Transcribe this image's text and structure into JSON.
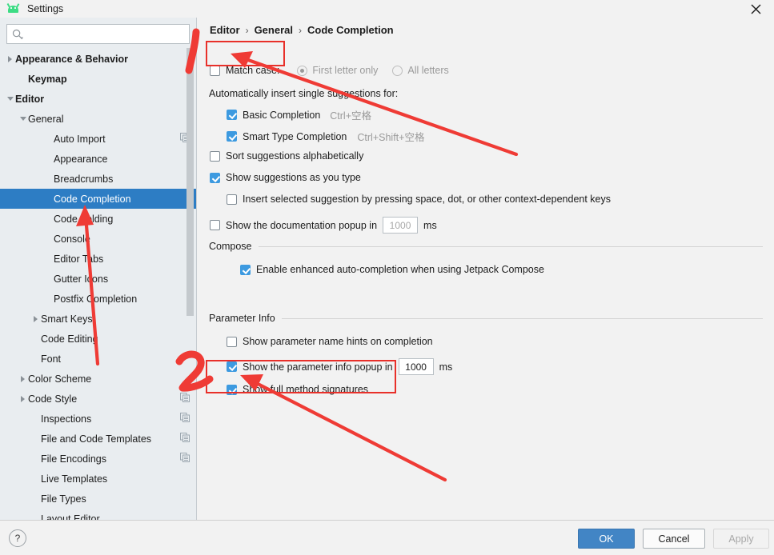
{
  "window": {
    "title": "Settings",
    "logo_icon": "android-logo-icon",
    "close_icon": "close-icon"
  },
  "sidebar": {
    "search": {
      "placeholder": "",
      "value": "",
      "icon": "search-icon"
    },
    "items": [
      {
        "label": "Appearance & Behavior",
        "indent": 0,
        "arrow": "right",
        "bold": true,
        "copy": false,
        "selected": false
      },
      {
        "label": "Keymap",
        "indent": 1,
        "arrow": "none",
        "bold": true,
        "copy": false,
        "selected": false
      },
      {
        "label": "Editor",
        "indent": 0,
        "arrow": "down",
        "bold": true,
        "copy": false,
        "selected": false
      },
      {
        "label": "General",
        "indent": 1,
        "arrow": "down",
        "bold": false,
        "copy": false,
        "selected": false
      },
      {
        "label": "Auto Import",
        "indent": 3,
        "arrow": "none",
        "bold": false,
        "copy": true,
        "selected": false
      },
      {
        "label": "Appearance",
        "indent": 3,
        "arrow": "none",
        "bold": false,
        "copy": false,
        "selected": false
      },
      {
        "label": "Breadcrumbs",
        "indent": 3,
        "arrow": "none",
        "bold": false,
        "copy": false,
        "selected": false
      },
      {
        "label": "Code Completion",
        "indent": 3,
        "arrow": "none",
        "bold": false,
        "copy": false,
        "selected": true
      },
      {
        "label": "Code Folding",
        "indent": 3,
        "arrow": "none",
        "bold": false,
        "copy": false,
        "selected": false
      },
      {
        "label": "Console",
        "indent": 3,
        "arrow": "none",
        "bold": false,
        "copy": false,
        "selected": false
      },
      {
        "label": "Editor Tabs",
        "indent": 3,
        "arrow": "none",
        "bold": false,
        "copy": false,
        "selected": false
      },
      {
        "label": "Gutter Icons",
        "indent": 3,
        "arrow": "none",
        "bold": false,
        "copy": false,
        "selected": false
      },
      {
        "label": "Postfix Completion",
        "indent": 3,
        "arrow": "none",
        "bold": false,
        "copy": false,
        "selected": false
      },
      {
        "label": "Smart Keys",
        "indent": 2,
        "arrow": "right",
        "bold": false,
        "copy": false,
        "selected": false
      },
      {
        "label": "Code Editing",
        "indent": 2,
        "arrow": "none",
        "bold": false,
        "copy": false,
        "selected": false
      },
      {
        "label": "Font",
        "indent": 2,
        "arrow": "none",
        "bold": false,
        "copy": false,
        "selected": false
      },
      {
        "label": "Color Scheme",
        "indent": 1,
        "arrow": "right",
        "bold": false,
        "copy": false,
        "selected": false
      },
      {
        "label": "Code Style",
        "indent": 1,
        "arrow": "right",
        "bold": false,
        "copy": true,
        "selected": false
      },
      {
        "label": "Inspections",
        "indent": 2,
        "arrow": "none",
        "bold": false,
        "copy": true,
        "selected": false
      },
      {
        "label": "File and Code Templates",
        "indent": 2,
        "arrow": "none",
        "bold": false,
        "copy": true,
        "selected": false
      },
      {
        "label": "File Encodings",
        "indent": 2,
        "arrow": "none",
        "bold": false,
        "copy": true,
        "selected": false
      },
      {
        "label": "Live Templates",
        "indent": 2,
        "arrow": "none",
        "bold": false,
        "copy": false,
        "selected": false
      },
      {
        "label": "File Types",
        "indent": 2,
        "arrow": "none",
        "bold": false,
        "copy": false,
        "selected": false
      },
      {
        "label": "Layout Editor",
        "indent": 2,
        "arrow": "none",
        "bold": false,
        "copy": false,
        "selected": false
      }
    ]
  },
  "breadcrumb": {
    "part1": "Editor",
    "sep1": "›",
    "part2": "General",
    "sep2": "›",
    "part3": "Code Completion"
  },
  "main": {
    "match_case": {
      "label": "Match case:",
      "checked": false
    },
    "first_letter_only": {
      "label": "First letter only",
      "selected": true,
      "disabled": true
    },
    "all_letters": {
      "label": "All letters",
      "selected": false,
      "disabled": true
    },
    "auto_insert_header": "Automatically insert single suggestions for:",
    "basic_completion": {
      "label": "Basic Completion",
      "shortcut": "Ctrl+空格",
      "checked": true
    },
    "smart_type_completion": {
      "label": "Smart Type Completion",
      "shortcut": "Ctrl+Shift+空格",
      "checked": true
    },
    "sort_alphabetically": {
      "label": "Sort suggestions alphabetically",
      "checked": false
    },
    "show_as_you_type": {
      "label": "Show suggestions as you type",
      "checked": true
    },
    "insert_selected": {
      "label": "Insert selected suggestion by pressing space, dot, or other context-dependent keys",
      "checked": false
    },
    "doc_popup": {
      "label": "Show the documentation popup in",
      "checked": false,
      "value": "1000",
      "unit": "ms"
    },
    "compose_group": "Compose",
    "compose_enable": {
      "label": "Enable enhanced auto-completion when using Jetpack Compose",
      "checked": true
    },
    "param_group": "Parameter Info",
    "param_name_hints": {
      "label": "Show parameter name hints on completion",
      "checked": false
    },
    "param_popup": {
      "label": "Show the parameter info popup in",
      "checked": true,
      "value": "1000",
      "unit": "ms"
    },
    "full_signatures": {
      "label": "Show full method signatures",
      "checked": true
    }
  },
  "bottom": {
    "help_label": "?",
    "ok": "OK",
    "cancel": "Cancel",
    "apply": "Apply"
  },
  "annotations": {
    "accent_color": "#e8302a",
    "marker_1": "1",
    "marker_2": "2",
    "box1_target": "Match case:",
    "box2_target": "Show full method signatures"
  },
  "colors": {
    "selection_blue": "#2d7dc4",
    "checkbox_blue": "#3d9ae0",
    "ok_button_blue": "#4285c5",
    "sidebar_bg": "#e9edf0",
    "content_bg": "#f2f2f2",
    "annotation_red": "#e8302a"
  }
}
